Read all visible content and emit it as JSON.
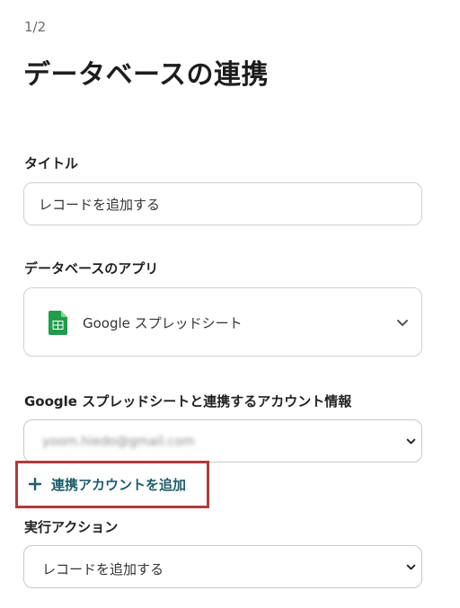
{
  "header": {
    "step": "1/2",
    "title": "データベースの連携"
  },
  "title_field": {
    "label": "タイトル",
    "value": "レコードを追加する"
  },
  "app_field": {
    "label": "データベースのアプリ",
    "selected_app": "Google スプレッドシート",
    "icon": "google-sheets-icon",
    "icon_color": "#1e9e4a"
  },
  "account_field": {
    "label": "Google スプレッドシートと連携するアカウント情報",
    "value": "yoom.hiedo@gmail.com",
    "value_obscured": true,
    "add_account_label": "連携アカウントを追加",
    "highlight_color": "#b23b3b"
  },
  "action_field": {
    "label": "実行アクション",
    "selected_action": "レコードを追加する"
  },
  "colors": {
    "link": "#1f5c6b",
    "border": "#cfcfcf"
  }
}
